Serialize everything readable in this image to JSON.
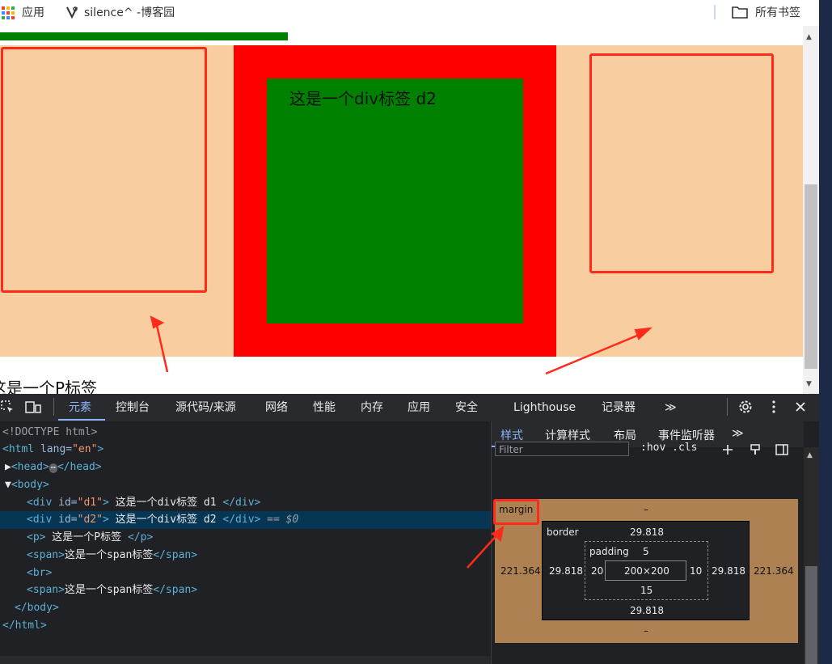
{
  "bookmarks": {
    "apps_label": "应用",
    "site_label": "silence^ -博客园",
    "all_bookmarks_label": "所有书签"
  },
  "page": {
    "d2_text": "这是一个div标签 d2",
    "p_text": "这是一个P标签"
  },
  "devtools": {
    "tabs": [
      "元素",
      "控制台",
      "源代码/来源",
      "网络",
      "性能",
      "内存",
      "应用",
      "安全",
      "Lighthouse",
      "记录器"
    ],
    "more_tabs": "≫",
    "elements_lines": {
      "l1": "<!DOCTYPE html>",
      "l2_open": "<html ",
      "l2_attr": "lang=",
      "l2_val": "\"en\"",
      "l2_close": ">",
      "l3_head": "<head>",
      "l3_ellipsis": "⋯",
      "l3_endhead": "</head>",
      "l4_body": "<body>",
      "l5_open": "<div ",
      "l5_attr": "id=",
      "l5_val": "\"d1\"",
      "l5_close": ">",
      "l5_text": " 这是一个div标签 d1 ",
      "l5_end": "</div>",
      "l6_open": "<div ",
      "l6_attr": "id=",
      "l6_val": "\"d2\"",
      "l6_close": ">",
      "l6_text": " 这是一个div标签 d2 ",
      "l6_end": "</div>",
      "l6_ref": " == $0",
      "l7_open": "<p>",
      "l7_text": " 这是一个P标签 ",
      "l7_end": "</p>",
      "l8_open": "<span>",
      "l8_text": "这是一个span标签",
      "l8_end": "</span>",
      "l9_br": "<br>",
      "l10_open": "<span>",
      "l10_text": "这是一个span标签",
      "l10_end": "</span>",
      "l11": "</body>",
      "l12": "</html>"
    },
    "right_tabs": [
      "样式",
      "计算样式",
      "布局",
      "事件监听器"
    ],
    "right_more": "≫",
    "filter_placeholder": "Filter",
    "filter_tools": ":hov .cls",
    "box_model": {
      "margin_label": "margin",
      "margin_top": "–",
      "margin_bottom": "–",
      "margin_left": "221.364",
      "margin_right": "221.364",
      "border_label": "border",
      "border_top": "29.818",
      "border_bottom": "29.818",
      "border_left": "29.818",
      "border_right": "29.818",
      "padding_label": "padding",
      "padding_top": "5",
      "padding_bottom": "15",
      "padding_left": "20",
      "padding_right": "10",
      "content": "200×200"
    }
  },
  "colors": {
    "accent": "#8ab4f8",
    "annotation": "#ff2a1a",
    "peach": "#f8cda0",
    "green": "#008000",
    "red": "#ff0000"
  }
}
